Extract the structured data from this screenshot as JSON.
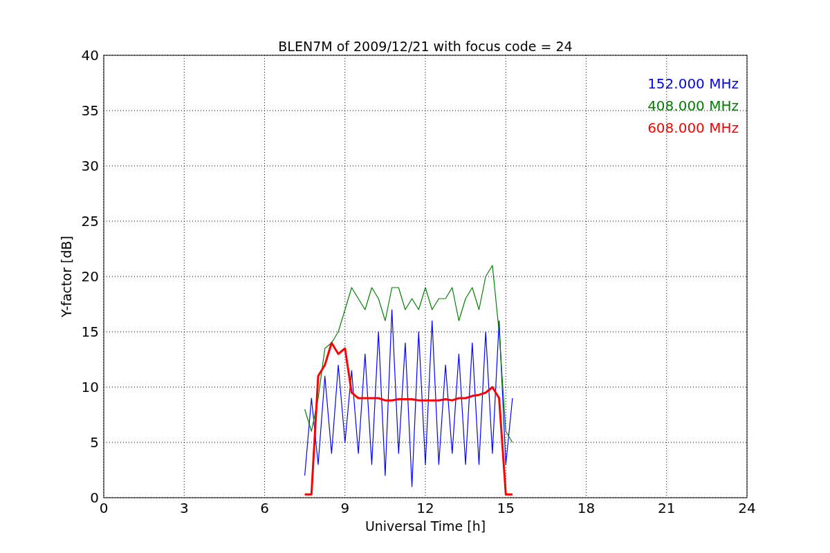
{
  "chart_data": {
    "type": "line",
    "title": "BLEN7M of 2009/12/21 with focus code = 24",
    "xlabel": "Universal Time [h]",
    "ylabel": "Y-factor [dB]",
    "x": [
      7.5,
      7.75,
      8,
      8.25,
      8.5,
      8.75,
      9,
      9.25,
      9.5,
      9.75,
      10,
      10.25,
      10.5,
      10.75,
      11,
      11.25,
      11.5,
      11.75,
      12,
      12.25,
      12.5,
      12.75,
      13,
      13.25,
      13.5,
      13.75,
      14,
      14.25,
      14.5,
      14.75,
      15,
      15.25
    ],
    "series": [
      {
        "name": "152.000 MHz",
        "color": "#0000ff",
        "values": [
          2,
          9,
          3,
          11,
          4,
          12,
          5,
          11.5,
          4,
          13,
          3,
          15,
          2,
          17,
          4,
          14,
          1,
          15,
          3,
          16,
          3,
          12,
          4,
          13,
          3,
          14,
          3,
          15,
          4,
          16,
          3,
          9
        ]
      },
      {
        "name": "408.000 MHz",
        "color": "#008000",
        "values": [
          8,
          6,
          9,
          13.5,
          14,
          15,
          17,
          19,
          18,
          17,
          19,
          18,
          16,
          19,
          19,
          17,
          18,
          17,
          19,
          17,
          18,
          18,
          19,
          16,
          18,
          19,
          17,
          20,
          21,
          15,
          6,
          5
        ]
      },
      {
        "name": "608.000 MHz",
        "color": "#ff0000",
        "values": [
          0.3,
          0.3,
          11,
          12,
          14,
          13,
          13.5,
          9.5,
          9,
          9,
          9,
          9,
          8.8,
          8.8,
          8.9,
          8.9,
          8.9,
          8.8,
          8.8,
          8.8,
          8.8,
          8.9,
          8.8,
          9,
          9,
          9.2,
          9.3,
          9.5,
          10,
          9,
          0.3,
          0.3
        ]
      }
    ],
    "xlim": [
      0,
      24
    ],
    "ylim": [
      0,
      40
    ],
    "xticks": [
      0,
      3,
      6,
      9,
      12,
      15,
      18,
      21,
      24
    ],
    "yticks": [
      0,
      5,
      10,
      15,
      20,
      25,
      30,
      35,
      40
    ],
    "grid": true
  }
}
